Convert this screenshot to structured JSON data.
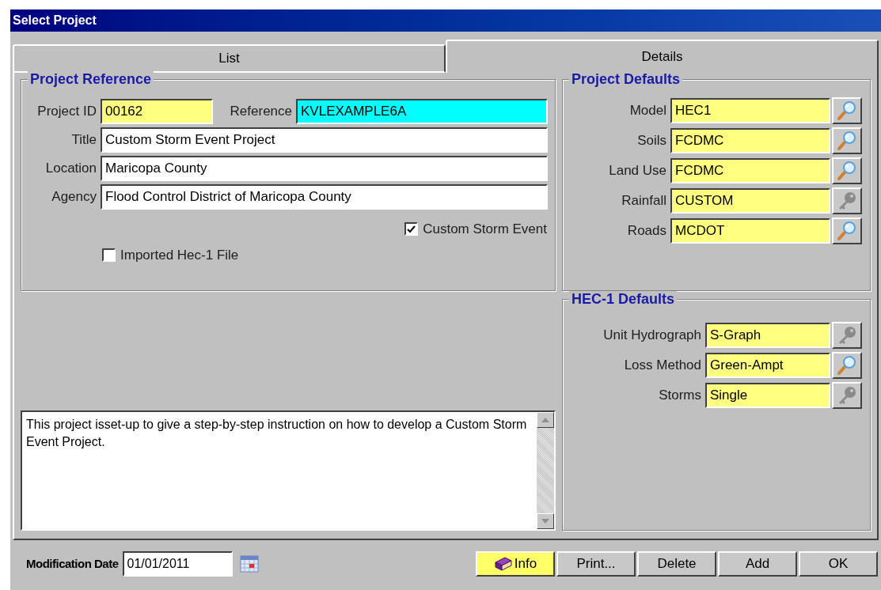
{
  "window": {
    "title": "Select Project"
  },
  "tabs": [
    {
      "label": "List",
      "selected": false
    },
    {
      "label": "Details",
      "selected": true
    }
  ],
  "project_reference": {
    "title": "Project Reference",
    "project_id": {
      "label": "Project ID",
      "value": "00162"
    },
    "reference": {
      "label": "Reference",
      "value": "KVLEXAMPLE6A"
    },
    "fields": [
      {
        "label": "Title",
        "value": "Custom Storm Event Project"
      },
      {
        "label": "Location",
        "value": "Maricopa County"
      },
      {
        "label": "Agency",
        "value": "Flood Control District of Maricopa County"
      }
    ],
    "custom_storm_event": {
      "label": "Custom Storm Event",
      "checked": true
    },
    "imported_hec1_file": {
      "label": "Imported Hec-1 File",
      "checked": false
    }
  },
  "description": "This project isset-up to give a step-by-step instruction on how to develop a Custom Storm Event Project.",
  "project_defaults": {
    "title": "Project Defaults",
    "rows": [
      {
        "label": "Model",
        "value": "HEC1",
        "disabled": false
      },
      {
        "label": "Soils",
        "value": "FCDMC",
        "disabled": false
      },
      {
        "label": "Land Use",
        "value": "FCDMC",
        "disabled": false
      },
      {
        "label": "Rainfall",
        "value": "CUSTOM",
        "disabled": true
      },
      {
        "label": "Roads",
        "value": "MCDOT",
        "disabled": false
      }
    ]
  },
  "hec1_defaults": {
    "title": "HEC-1 Defaults",
    "rows": [
      {
        "label": "Unit Hydrograph",
        "value": "S-Graph",
        "disabled": true
      },
      {
        "label": "Loss Method",
        "value": "Green-Ampt",
        "disabled": false
      },
      {
        "label": "Storms",
        "value": "Single",
        "disabled": true
      }
    ]
  },
  "modification_date": {
    "label": "Modification Date",
    "value": "01/01/2011"
  },
  "buttons": [
    {
      "label": "Info",
      "highlighted": true,
      "kind": "info"
    },
    {
      "label": "Print...",
      "highlighted": false,
      "kind": "plain"
    },
    {
      "label": "Delete",
      "highlighted": false,
      "kind": "plain"
    },
    {
      "label": "Add",
      "highlighted": false,
      "kind": "plain"
    },
    {
      "label": "OK",
      "highlighted": false,
      "kind": "plain"
    }
  ]
}
